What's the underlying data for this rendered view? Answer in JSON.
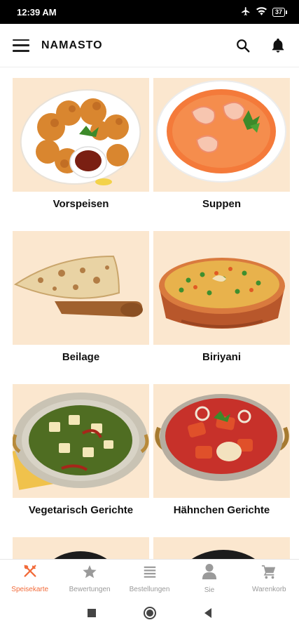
{
  "status_bar": {
    "time": "12:39 AM",
    "battery": "37"
  },
  "app_bar": {
    "title": "NAMASTO",
    "icons": [
      "menu-icon",
      "search-icon",
      "bell-icon"
    ]
  },
  "categories": [
    {
      "label": "Vorspeisen",
      "image": "fried-chicken-dish"
    },
    {
      "label": "Suppen",
      "image": "shrimp-soup-bowl"
    },
    {
      "label": "Beilage",
      "image": "naan-bread"
    },
    {
      "label": "Biriyani",
      "image": "biryani-pot"
    },
    {
      "label": "Vegetarisch Gerichte",
      "image": "palak-paneer-bowl"
    },
    {
      "label": "Hähnchen Gerichte",
      "image": "chicken-curry-bowl"
    },
    {
      "label": "",
      "image": "partial-dish"
    },
    {
      "label": "",
      "image": "partial-dish"
    }
  ],
  "bottom_nav": [
    {
      "label": "Speisekarte",
      "icon": "cutlery-icon",
      "active": true
    },
    {
      "label": "Bewertungen",
      "icon": "star-icon",
      "active": false
    },
    {
      "label": "Bestellungen",
      "icon": "list-icon",
      "active": false
    },
    {
      "label": "Sie",
      "icon": "person-icon",
      "active": false
    },
    {
      "label": "Warenkorb",
      "icon": "cart-icon",
      "active": false
    }
  ],
  "colors": {
    "accent": "#f26b3a",
    "card_bg": "#fbe7cf",
    "inactive": "#9a9a9a"
  }
}
